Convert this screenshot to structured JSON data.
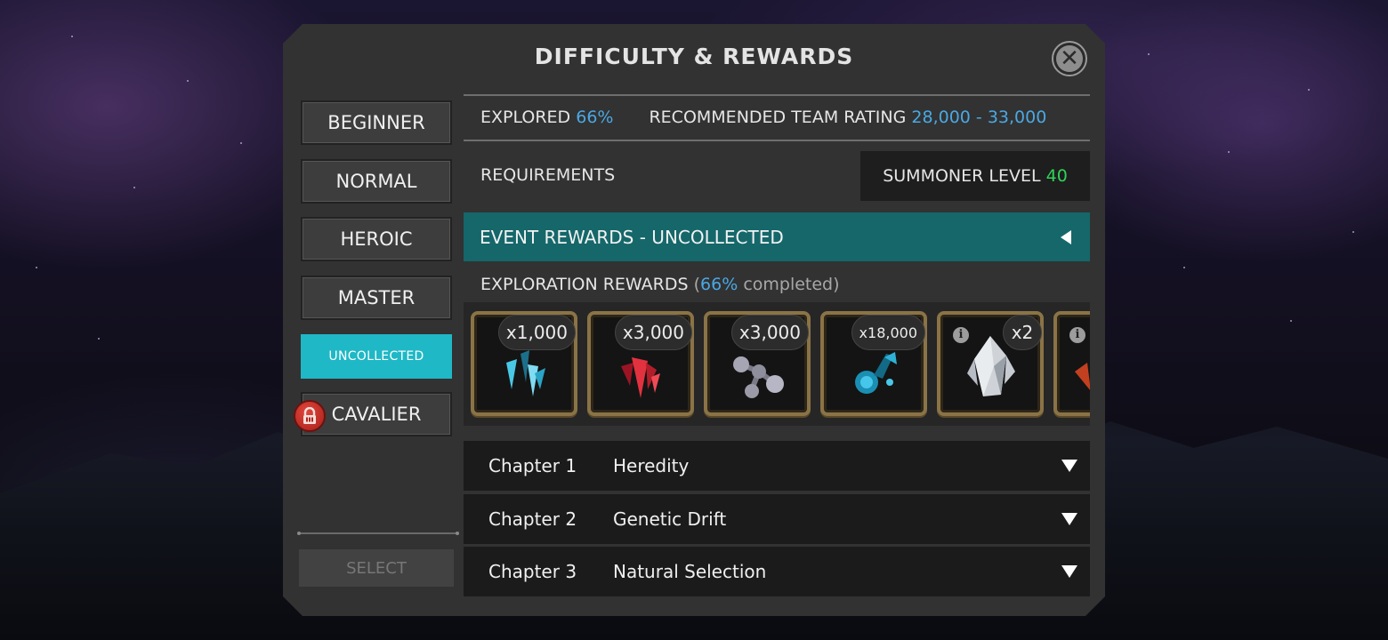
{
  "dialog": {
    "title": "DIFFICULTY & REWARDS",
    "close_icon": "close-icon"
  },
  "difficulties": [
    {
      "label": "BEGINNER",
      "state": "normal"
    },
    {
      "label": "NORMAL",
      "state": "normal"
    },
    {
      "label": "HEROIC",
      "state": "normal"
    },
    {
      "label": "MASTER",
      "state": "normal"
    },
    {
      "label": "UNCOLLECTED",
      "state": "selected"
    },
    {
      "label": "CAVALIER",
      "state": "locked",
      "icon": "lock-icon"
    }
  ],
  "select_label": "SELECT",
  "info": {
    "explored_label": "EXPLORED",
    "explored_value": "66%",
    "rating_label": "RECOMMENDED TEAM RATING",
    "rating_value": "28,000 - 33,000"
  },
  "requirements": {
    "label": "REQUIREMENTS",
    "summoner_label": "SUMMONER LEVEL",
    "summoner_value": "40"
  },
  "event_rewards": {
    "label": "EVENT REWARDS - UNCOLLECTED",
    "icon": "collapse-arrow-icon"
  },
  "exploration": {
    "label": "EXPLORATION REWARDS",
    "open_paren": "(",
    "percent": "66%",
    "suffix": "completed)"
  },
  "rewards": [
    {
      "icon": "shard-blue-icon",
      "qty": "x1,000"
    },
    {
      "icon": "crystal-red-icon",
      "qty": "x3,000"
    },
    {
      "icon": "molecule-gray-icon",
      "qty": "x3,000"
    },
    {
      "icon": "flask-blue-icon",
      "qty": "x18,000"
    },
    {
      "icon": "crystal-white-icon",
      "qty": "x2",
      "info": "i"
    },
    {
      "icon": "crystal-orange-icon",
      "qty": "",
      "info": "i"
    }
  ],
  "chapters": [
    {
      "num": "Chapter 1",
      "name": "Heredity"
    },
    {
      "num": "Chapter 2",
      "name": "Genetic Drift"
    },
    {
      "num": "Chapter 3",
      "name": "Natural Selection"
    }
  ],
  "colors": {
    "accent_teal": "#1fb8c6",
    "event_bar": "#15676a",
    "value_blue": "#4aa8e3",
    "level_green": "#2fd35a",
    "lock_red": "#c8302a"
  }
}
